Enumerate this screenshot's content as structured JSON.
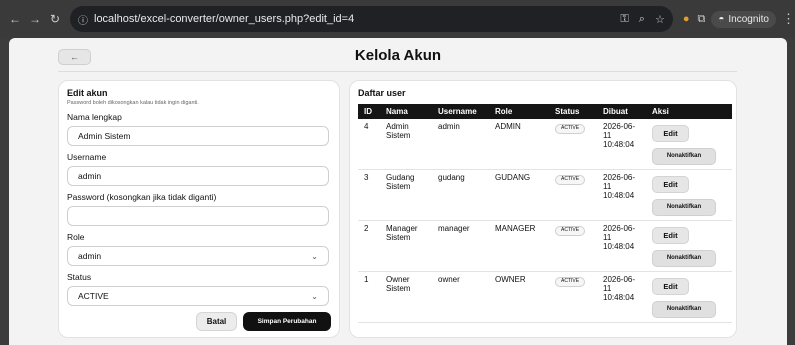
{
  "browser": {
    "url": "localhost/excel-converter/owner_users.php?edit_id=4",
    "incognito_label": "Incognito"
  },
  "page": {
    "title": "Kelola Akun",
    "back_label": "←"
  },
  "edit_form": {
    "title": "Edit akun",
    "subtitle": "Password boleh dikosongkan kalau tidak ingin diganti.",
    "name_label": "Nama lengkap",
    "name_value": "Admin Sistem",
    "username_label": "Username",
    "username_value": "admin",
    "password_label": "Password (kosongkan jika tidak diganti)",
    "password_value": "",
    "role_label": "Role",
    "role_value": "admin",
    "status_label": "Status",
    "status_value": "ACTIVE",
    "cancel_label": "Batal",
    "save_label": "Simpan Perubahan"
  },
  "user_list": {
    "title": "Daftar user",
    "columns": [
      "ID",
      "Nama",
      "Username",
      "Role",
      "Status",
      "Dibuat",
      "Aksi"
    ],
    "rows": [
      {
        "id": "4",
        "nama": "Admin Sistem",
        "username": "admin",
        "role": "ADMIN",
        "status": "ACTIVE",
        "dibuat": "2026-06-11 10:48:04",
        "edit": "Edit",
        "nonaktif": "Nonaktifkan"
      },
      {
        "id": "3",
        "nama": "Gudang Sistem",
        "username": "gudang",
        "role": "GUDANG",
        "status": "ACTIVE",
        "dibuat": "2026-06-11 10:48:04",
        "edit": "Edit",
        "nonaktif": "Nonaktifkan"
      },
      {
        "id": "2",
        "nama": "Manager Sistem",
        "username": "manager",
        "role": "MANAGER",
        "status": "ACTIVE",
        "dibuat": "2026-06-11 10:48:04",
        "edit": "Edit",
        "nonaktif": "Nonaktifkan"
      },
      {
        "id": "1",
        "nama": "Owner Sistem",
        "username": "owner",
        "role": "OWNER",
        "status": "ACTIVE",
        "dibuat": "2026-06-11 10:48:04",
        "edit": "Edit",
        "nonaktif": "Nonaktifkan"
      }
    ]
  }
}
